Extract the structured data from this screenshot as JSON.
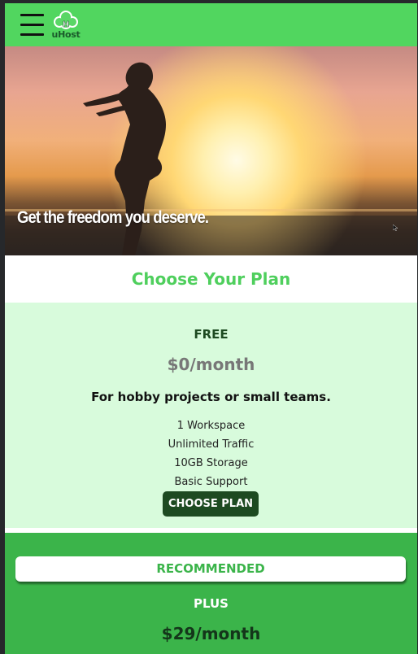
{
  "header": {
    "menu_icon": "hamburger-menu-icon",
    "logo_icon": "cloud-tree-logo-icon",
    "logo_text": "uHost",
    "background": "#51d65f"
  },
  "hero": {
    "caption": "Get the freedom you deserve.",
    "image": "silhouette-woman-sunset-beach"
  },
  "plans_section": {
    "heading": "Choose Your Plan",
    "heading_color": "#4fcf5d"
  },
  "plans": [
    {
      "name": "FREE",
      "price": "$0/month",
      "description": "For hobby projects or small teams.",
      "features": [
        "1 Workspace",
        "Unlimited Traffic",
        "10GB Storage",
        "Basic Support"
      ],
      "button_label": "CHOOSE PLAN",
      "background": "#d8fbdc",
      "button_color": "#1d4a21"
    },
    {
      "badge": "RECOMMENDED",
      "name": "PLUS",
      "price": "$29/month",
      "background": "#3bb44a"
    }
  ]
}
